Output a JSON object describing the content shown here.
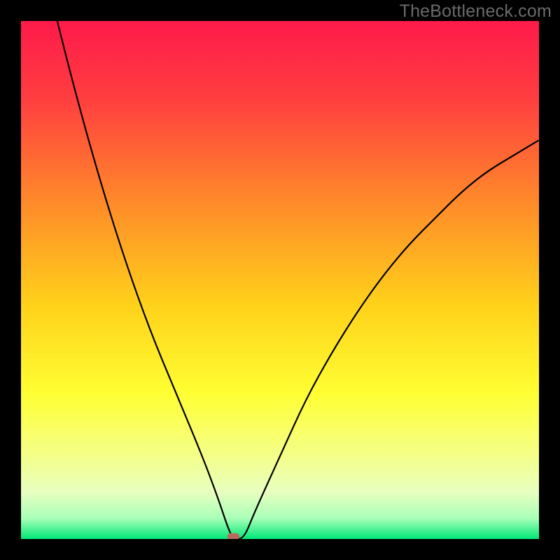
{
  "watermark": "TheBottleneck.com",
  "chart_data": {
    "type": "line",
    "title": "",
    "xlabel": "",
    "ylabel": "",
    "xlim": [
      0,
      100
    ],
    "ylim": [
      0,
      100
    ],
    "optimum_x": 41,
    "series": [
      {
        "name": "bottleneck-curve",
        "x": [
          0,
          5,
          10,
          15,
          20,
          25,
          30,
          35,
          38,
          40,
          41,
          43,
          45,
          50,
          55,
          60,
          65,
          70,
          75,
          80,
          85,
          90,
          95,
          100
        ],
        "values": [
          131,
          108,
          88,
          70,
          54,
          40,
          28,
          16,
          8,
          2,
          0,
          0,
          5,
          16,
          27,
          36,
          44,
          51,
          57,
          62,
          67,
          71,
          74,
          77
        ]
      }
    ],
    "marker": {
      "x": 41,
      "y": 0.5,
      "color": "#b96a5e"
    },
    "gradient_stops": [
      {
        "offset": 0.0,
        "color": "#ff1a4b"
      },
      {
        "offset": 0.15,
        "color": "#ff3e3f"
      },
      {
        "offset": 0.35,
        "color": "#ff8a2a"
      },
      {
        "offset": 0.55,
        "color": "#ffd21a"
      },
      {
        "offset": 0.72,
        "color": "#ffff33"
      },
      {
        "offset": 0.84,
        "color": "#f4ff8a"
      },
      {
        "offset": 0.91,
        "color": "#e8ffc0"
      },
      {
        "offset": 0.96,
        "color": "#a9ffb8"
      },
      {
        "offset": 1.0,
        "color": "#00e878"
      }
    ]
  }
}
